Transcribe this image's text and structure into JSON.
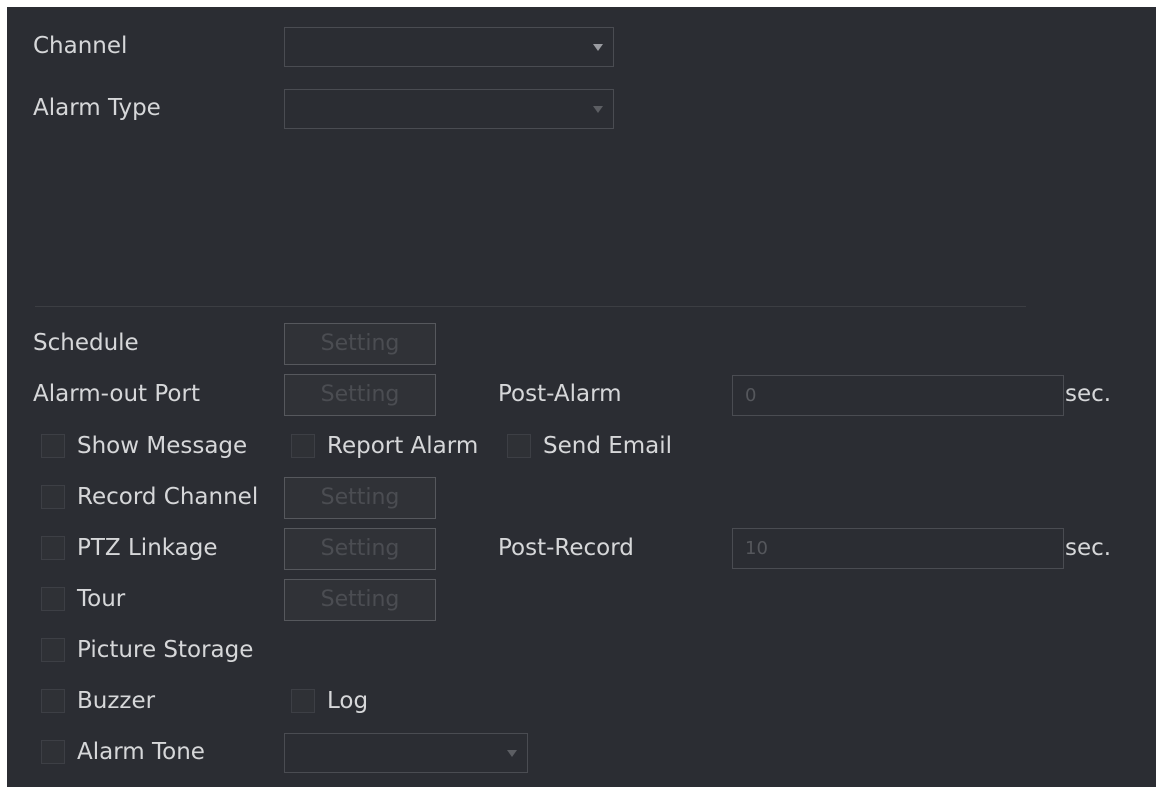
{
  "channel": {
    "label": "Channel",
    "value": ""
  },
  "alarm_type": {
    "label": "Alarm Type",
    "value": ""
  },
  "schedule": {
    "label": "Schedule",
    "button": "Setting"
  },
  "alarm_out_port": {
    "label": "Alarm-out Port",
    "button": "Setting"
  },
  "post_alarm": {
    "label": "Post-Alarm",
    "value": "0",
    "unit": "sec."
  },
  "show_message": {
    "label": "Show Message",
    "checked": false
  },
  "report_alarm": {
    "label": "Report Alarm",
    "checked": false
  },
  "send_email": {
    "label": "Send Email",
    "checked": false
  },
  "record_channel": {
    "label": "Record Channel",
    "button": "Setting",
    "checked": false
  },
  "ptz_linkage": {
    "label": "PTZ Linkage",
    "button": "Setting",
    "checked": false
  },
  "post_record": {
    "label": "Post-Record",
    "value": "10",
    "unit": "sec."
  },
  "tour": {
    "label": "Tour",
    "button": "Setting",
    "checked": false
  },
  "picture_storage": {
    "label": "Picture Storage",
    "checked": false
  },
  "buzzer": {
    "label": "Buzzer",
    "checked": false
  },
  "log": {
    "label": "Log",
    "checked": false
  },
  "alarm_tone": {
    "label": "Alarm Tone",
    "value": "",
    "checked": false
  },
  "icons": {
    "dropdown": "chevron-down-icon"
  },
  "colors": {
    "background": "#2b2d33",
    "text": "#d6d7d9",
    "border": "#4a4c52"
  }
}
